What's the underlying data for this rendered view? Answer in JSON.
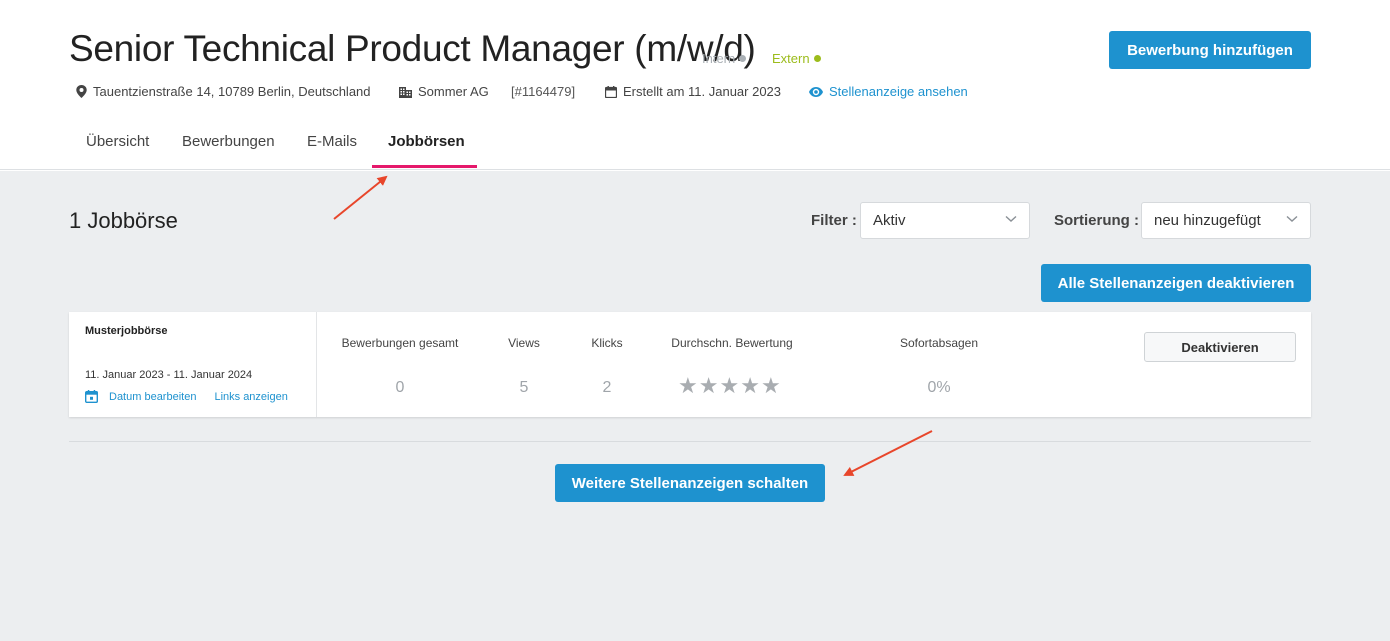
{
  "header": {
    "title": "Senior Technical Product Manager (m/w/d)",
    "status_intern": "Intern",
    "status_extern": "Extern",
    "add_application_button": "Bewerbung hinzufügen",
    "address": "Tauentzienstraße 14, 10789 Berlin, Deutschland",
    "company": "Sommer AG",
    "job_id": "[#1164479]",
    "created": "Erstellt am 11. Januar 2023",
    "view_posting_link": "Stellenanzeige ansehen"
  },
  "tabs": [
    {
      "label": "Übersicht",
      "active": false
    },
    {
      "label": "Bewerbungen",
      "active": false
    },
    {
      "label": "E-Mails",
      "active": false
    },
    {
      "label": "Jobbörsen",
      "active": true
    }
  ],
  "toolbar": {
    "count_label": "1 Jobbörse",
    "filter_label": "Filter :",
    "filter_value": "Aktiv",
    "sort_label": "Sortierung :",
    "sort_value": "neu hinzugefügt",
    "deactivate_all_button": "Alle Stellenanzeigen deaktivieren"
  },
  "job_boards": [
    {
      "name": "Musterjobbörse",
      "date_range": "11. Januar 2023 - 11. Januar 2024",
      "edit_date_link": "Datum bearbeiten",
      "show_links_link": "Links anzeigen",
      "stats_headers": [
        "Bewerbungen gesamt",
        "Views",
        "Klicks",
        "Durchschn. Bewertung",
        "Sofortabsagen"
      ],
      "applications_total": "0",
      "views": "5",
      "clicks": "2",
      "avg_rating": 0,
      "rating_max": 5,
      "instant_rejections": "0%",
      "deactivate_button": "Deaktivieren"
    }
  ],
  "more_postings_button": "Weitere Stellenanzeigen schalten",
  "colors": {
    "primary": "#1e92cf",
    "active_tab": "#e5186b",
    "extern": "#9cbc1c",
    "annotation_arrow": "#e8462b"
  }
}
